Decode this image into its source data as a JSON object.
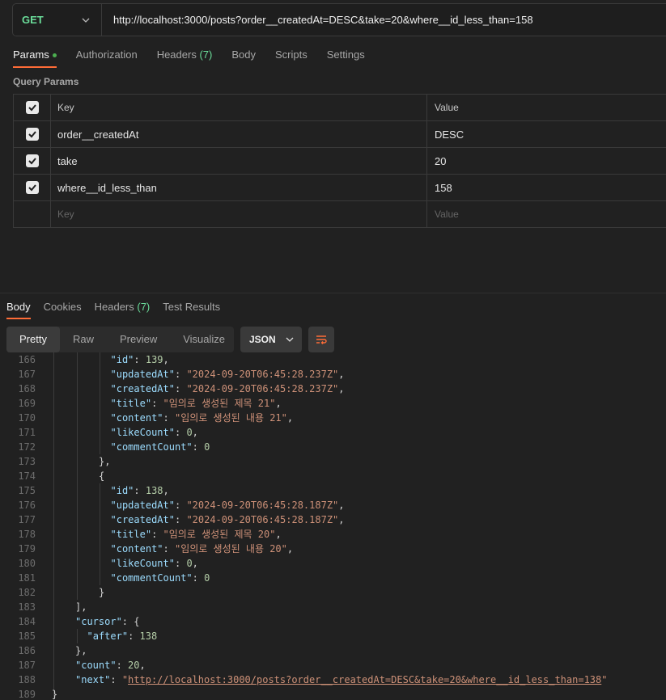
{
  "request": {
    "method": "GET",
    "url": "http://localhost:3000/posts?order__createdAt=DESC&take=20&where__id_less_than=158"
  },
  "request_tabs": [
    {
      "label": "Params",
      "badge": ""
    },
    {
      "label": "Authorization",
      "badge": ""
    },
    {
      "label": "Headers",
      "badge": "(7)"
    },
    {
      "label": "Body",
      "badge": ""
    },
    {
      "label": "Scripts",
      "badge": ""
    },
    {
      "label": "Settings",
      "badge": ""
    }
  ],
  "query_params": {
    "title": "Query Params",
    "header": {
      "key": "Key",
      "value": "Value"
    },
    "rows": [
      {
        "key": "order__createdAt",
        "value": "DESC"
      },
      {
        "key": "take",
        "value": "20"
      },
      {
        "key": "where__id_less_than",
        "value": "158"
      }
    ],
    "placeholder": {
      "key": "Key",
      "value": "Value"
    }
  },
  "response_tabs": [
    {
      "label": "Body",
      "badge": ""
    },
    {
      "label": "Cookies",
      "badge": ""
    },
    {
      "label": "Headers",
      "badge": "(7)"
    },
    {
      "label": "Test Results",
      "badge": ""
    }
  ],
  "view_modes": [
    "Pretty",
    "Raw",
    "Preview",
    "Visualize"
  ],
  "format": "JSON",
  "colors": {
    "accent": "#ff6c37",
    "method": "#6bdd9a",
    "key": "#9cdcfe",
    "string": "#ce9178",
    "number": "#b5cea8"
  },
  "code_lines": [
    {
      "num": "166",
      "indent": 5,
      "tokens": [
        [
          "k",
          "\"id\""
        ],
        [
          "p",
          ": "
        ],
        [
          "n",
          "139"
        ],
        [
          "p",
          ","
        ]
      ]
    },
    {
      "num": "167",
      "indent": 5,
      "tokens": [
        [
          "k",
          "\"updatedAt\""
        ],
        [
          "p",
          ": "
        ],
        [
          "s",
          "\"2024-09-20T06:45:28.237Z\""
        ],
        [
          "p",
          ","
        ]
      ]
    },
    {
      "num": "168",
      "indent": 5,
      "tokens": [
        [
          "k",
          "\"createdAt\""
        ],
        [
          "p",
          ": "
        ],
        [
          "s",
          "\"2024-09-20T06:45:28.237Z\""
        ],
        [
          "p",
          ","
        ]
      ]
    },
    {
      "num": "169",
      "indent": 5,
      "tokens": [
        [
          "k",
          "\"title\""
        ],
        [
          "p",
          ": "
        ],
        [
          "s",
          "\"임의로 생성된 제목 21\""
        ],
        [
          "p",
          ","
        ]
      ]
    },
    {
      "num": "170",
      "indent": 5,
      "tokens": [
        [
          "k",
          "\"content\""
        ],
        [
          "p",
          ": "
        ],
        [
          "s",
          "\"임의로 생성된 내용 21\""
        ],
        [
          "p",
          ","
        ]
      ]
    },
    {
      "num": "171",
      "indent": 5,
      "tokens": [
        [
          "k",
          "\"likeCount\""
        ],
        [
          "p",
          ": "
        ],
        [
          "n",
          "0"
        ],
        [
          "p",
          ","
        ]
      ]
    },
    {
      "num": "172",
      "indent": 5,
      "tokens": [
        [
          "k",
          "\"commentCount\""
        ],
        [
          "p",
          ": "
        ],
        [
          "n",
          "0"
        ]
      ]
    },
    {
      "num": "173",
      "indent": 4,
      "tokens": [
        [
          "p",
          "},"
        ]
      ]
    },
    {
      "num": "174",
      "indent": 4,
      "tokens": [
        [
          "p",
          "{"
        ]
      ]
    },
    {
      "num": "175",
      "indent": 5,
      "tokens": [
        [
          "k",
          "\"id\""
        ],
        [
          "p",
          ": "
        ],
        [
          "n",
          "138"
        ],
        [
          "p",
          ","
        ]
      ]
    },
    {
      "num": "176",
      "indent": 5,
      "tokens": [
        [
          "k",
          "\"updatedAt\""
        ],
        [
          "p",
          ": "
        ],
        [
          "s",
          "\"2024-09-20T06:45:28.187Z\""
        ],
        [
          "p",
          ","
        ]
      ]
    },
    {
      "num": "177",
      "indent": 5,
      "tokens": [
        [
          "k",
          "\"createdAt\""
        ],
        [
          "p",
          ": "
        ],
        [
          "s",
          "\"2024-09-20T06:45:28.187Z\""
        ],
        [
          "p",
          ","
        ]
      ]
    },
    {
      "num": "178",
      "indent": 5,
      "tokens": [
        [
          "k",
          "\"title\""
        ],
        [
          "p",
          ": "
        ],
        [
          "s",
          "\"임의로 생성된 제목 20\""
        ],
        [
          "p",
          ","
        ]
      ]
    },
    {
      "num": "179",
      "indent": 5,
      "tokens": [
        [
          "k",
          "\"content\""
        ],
        [
          "p",
          ": "
        ],
        [
          "s",
          "\"임의로 생성된 내용 20\""
        ],
        [
          "p",
          ","
        ]
      ]
    },
    {
      "num": "180",
      "indent": 5,
      "tokens": [
        [
          "k",
          "\"likeCount\""
        ],
        [
          "p",
          ": "
        ],
        [
          "n",
          "0"
        ],
        [
          "p",
          ","
        ]
      ]
    },
    {
      "num": "181",
      "indent": 5,
      "tokens": [
        [
          "k",
          "\"commentCount\""
        ],
        [
          "p",
          ": "
        ],
        [
          "n",
          "0"
        ]
      ]
    },
    {
      "num": "182",
      "indent": 4,
      "tokens": [
        [
          "p",
          "}"
        ]
      ]
    },
    {
      "num": "183",
      "indent": 2,
      "tokens": [
        [
          "p",
          "],"
        ]
      ]
    },
    {
      "num": "184",
      "indent": 2,
      "tokens": [
        [
          "k",
          "\"cursor\""
        ],
        [
          "p",
          ": {"
        ]
      ]
    },
    {
      "num": "185",
      "indent": 3,
      "tokens": [
        [
          "k",
          "\"after\""
        ],
        [
          "p",
          ": "
        ],
        [
          "n",
          "138"
        ]
      ]
    },
    {
      "num": "186",
      "indent": 2,
      "tokens": [
        [
          "p",
          "},"
        ]
      ]
    },
    {
      "num": "187",
      "indent": 2,
      "tokens": [
        [
          "k",
          "\"count\""
        ],
        [
          "p",
          ": "
        ],
        [
          "n",
          "20"
        ],
        [
          "p",
          ","
        ]
      ]
    },
    {
      "num": "188",
      "indent": 2,
      "tokens": [
        [
          "k",
          "\"next\""
        ],
        [
          "p",
          ": "
        ],
        [
          "s",
          "\""
        ],
        [
          "link",
          "http://localhost:3000/posts?order__createdAt=DESC&take=20&where__id_less_than=138"
        ],
        [
          "s",
          "\""
        ]
      ]
    },
    {
      "num": "189",
      "indent": 0,
      "tokens": [
        [
          "p",
          "}"
        ]
      ]
    }
  ]
}
